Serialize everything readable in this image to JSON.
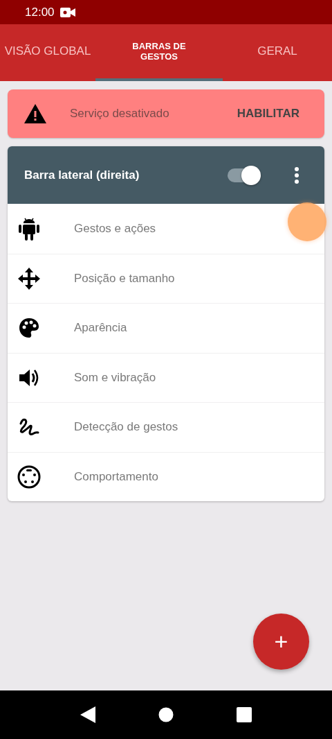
{
  "status_bar": {
    "time": "12:00"
  },
  "tabs": [
    {
      "label": "VISÃO GLOBAL",
      "selected": false
    },
    {
      "label": "BARRAS DE GESTOS",
      "selected": true
    },
    {
      "label": "GERAL",
      "selected": false
    }
  ],
  "banner": {
    "message": "Serviço desativado",
    "action": "HABILITAR"
  },
  "bar_card": {
    "title": "Barra lateral (direita)",
    "on": true,
    "items": [
      {
        "kind": "android",
        "label": "Gestos e ações"
      },
      {
        "kind": "move",
        "label": "Posição e tamanho"
      },
      {
        "kind": "palette",
        "label": "Aparência"
      },
      {
        "kind": "sound",
        "label": "Som e vibração"
      },
      {
        "kind": "gesture",
        "label": "Detecção de gestos"
      },
      {
        "kind": "behavior",
        "label": "Comportamento"
      }
    ]
  },
  "fab": {
    "label": "+"
  }
}
